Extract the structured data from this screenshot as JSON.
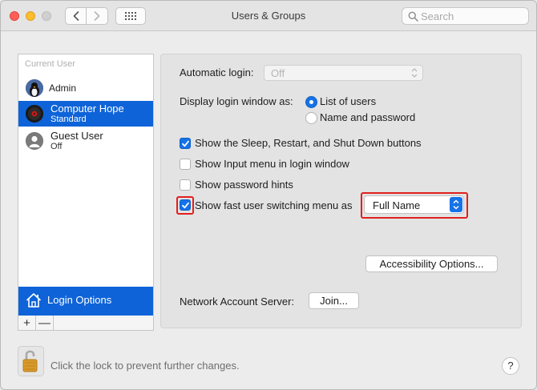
{
  "window": {
    "title": "Users & Groups",
    "search_placeholder": "Search"
  },
  "sidebar": {
    "section_label": "Current User",
    "users": [
      {
        "name": "Admin",
        "sub": ""
      },
      {
        "name": "Computer Hope",
        "sub": "Standard",
        "selected": true
      },
      {
        "name": "Guest User",
        "sub": "Off"
      }
    ],
    "login_options_label": "Login Options",
    "add_label": "+",
    "remove_label": "—"
  },
  "panel": {
    "automatic_login_label": "Automatic login:",
    "automatic_login_value": "Off",
    "display_login_label": "Display login window as:",
    "radio_list_label": "List of users",
    "radio_name_label": "Name and password",
    "radio_selected": "List of users",
    "opt_sleep_label": "Show the Sleep, Restart, and Shut Down buttons",
    "opt_sleep_checked": true,
    "opt_input_label": "Show Input menu in login window",
    "opt_input_checked": false,
    "opt_hints_label": "Show password hints",
    "opt_hints_checked": false,
    "opt_fast_label": "Show fast user switching menu as",
    "opt_fast_checked": true,
    "fast_switch_value": "Full Name",
    "accessibility_button": "Accessibility Options...",
    "network_label": "Network Account Server:",
    "join_button": "Join..."
  },
  "footer": {
    "lock_text": "Click the lock to prevent further changes.",
    "help_label": "?"
  },
  "colors": {
    "accent": "#0e63d8",
    "highlight": "#e0201f"
  },
  "icons": [
    "search-icon",
    "chevron-left-icon",
    "chevron-right-icon",
    "grid-icon",
    "house-icon",
    "lock-icon",
    "checkmark-icon"
  ]
}
